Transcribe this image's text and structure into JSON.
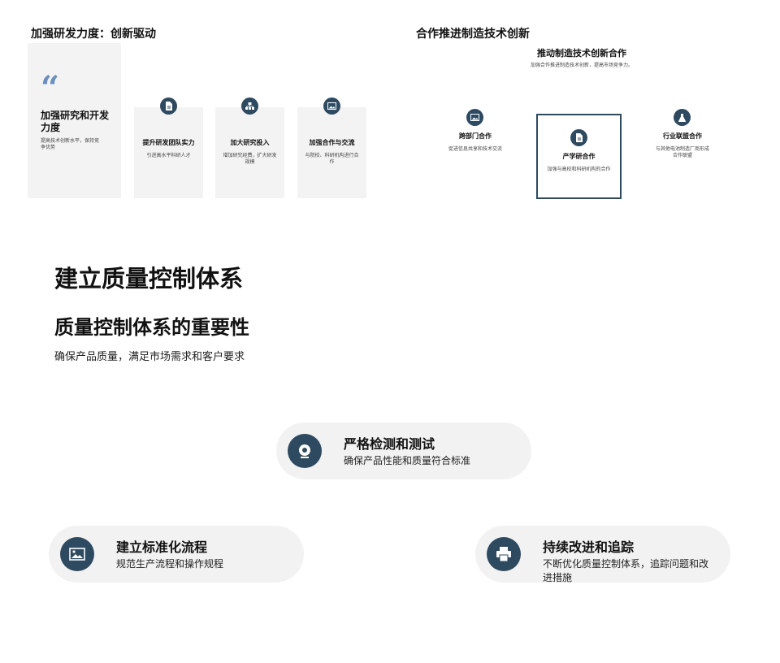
{
  "slide1": {
    "title": "加强研发力度：创新驱动",
    "quote_card": {
      "heading": "加强研究和开发力度",
      "desc": "提高技术创新水平，保持竞争优势"
    },
    "cards": [
      {
        "icon": "document-icon",
        "heading": "提升研发团队实力",
        "desc": "引进高水平科研人才"
      },
      {
        "icon": "sitemap-icon",
        "heading": "加大研究投入",
        "desc": "增加研究经费，扩大研发规模"
      },
      {
        "icon": "image-icon",
        "heading": "加强合作与交流",
        "desc": "与院校、科研机构进行合作"
      }
    ]
  },
  "slide2": {
    "title": "合作推进制造技术创新",
    "subtitle": "推动制造技术创新合作",
    "subdesc": "加强合作推进制造技术创新，提高市场竞争力。",
    "items": [
      {
        "icon": "image-icon",
        "heading": "跨部门合作",
        "desc": "促进信息共享和技术交流"
      },
      {
        "icon": "document-icon",
        "heading": "产学研合作",
        "desc": "加强与高校和科研机构的合作"
      },
      {
        "icon": "flask-icon",
        "heading": "行业联盟合作",
        "desc": "与其他电池制造厂商形成合作联盟"
      }
    ]
  },
  "slide3": {
    "title": "建立质量控制体系",
    "subtitle": "质量控制体系的重要性",
    "desc": "确保产品质量，满足市场需求和客户要求",
    "pills": [
      {
        "icon": "webcam-icon",
        "heading": "严格检测和测试",
        "desc": "确保产品性能和质量符合标准"
      },
      {
        "icon": "image-icon",
        "heading": "建立标准化流程",
        "desc": "规范生产流程和操作规程"
      },
      {
        "icon": "printer-icon",
        "heading": "持续改进和追踪",
        "desc": "不断优化质量控制体系，追踪问题和改进措施"
      }
    ]
  },
  "colors": {
    "accent": "#2e4a60",
    "quote": "#6b8fbf",
    "card_bg": "#f3f3f3"
  }
}
